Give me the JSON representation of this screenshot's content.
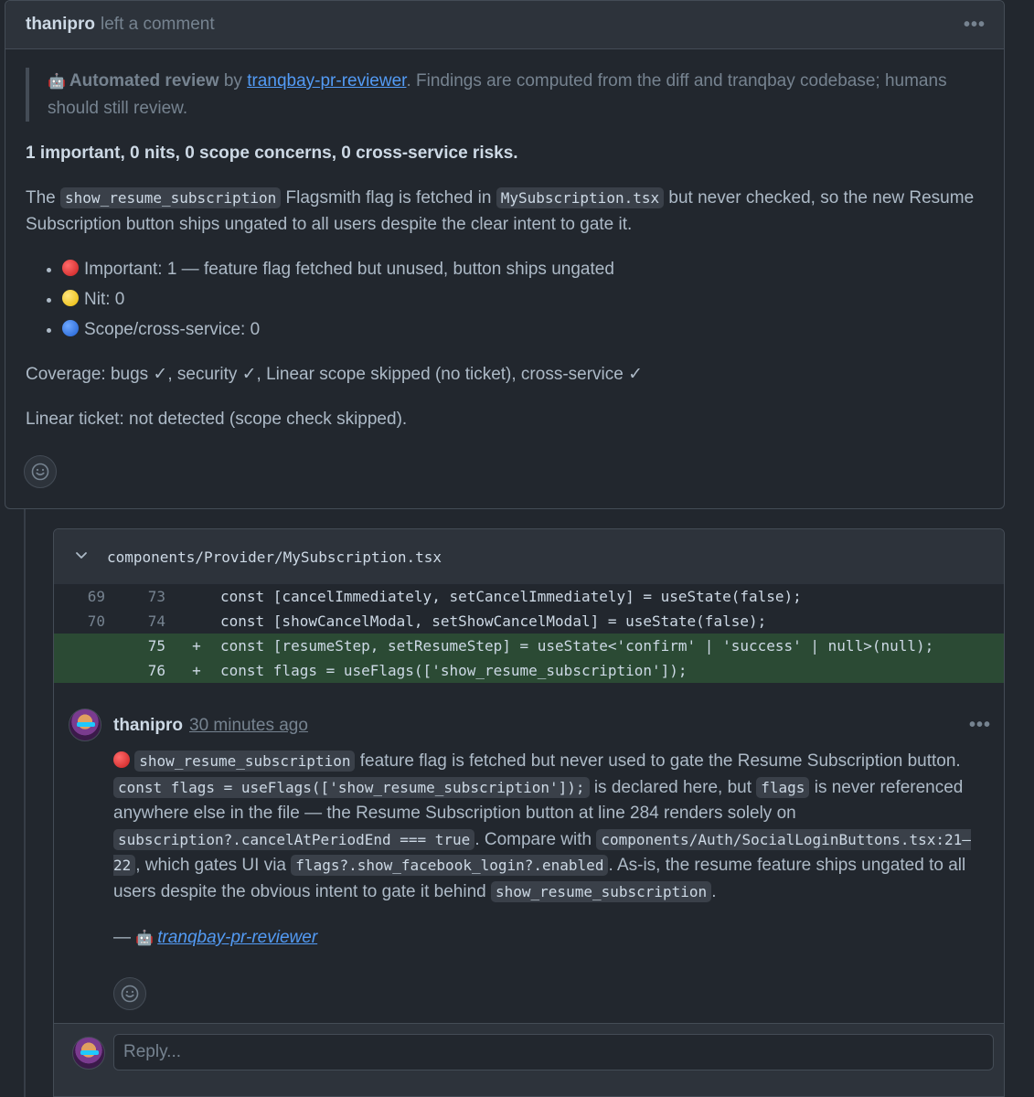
{
  "header": {
    "author": "thanipro",
    "action": "left a comment",
    "menu_label": "•••"
  },
  "review": {
    "quote_bot_emoji": "🤖",
    "quote_bold": "Automated review",
    "quote_by": " by ",
    "quote_link": "tranqbay-pr-reviewer",
    "quote_rest": ". Findings are computed from the diff and tranqbay codebase; humans should still review.",
    "summary": "1 important, 0 nits, 0 scope concerns, 0 cross-service risks.",
    "desc_1": "The ",
    "desc_code_1": "show_resume_subscription",
    "desc_2": " Flagsmith flag is fetched in ",
    "desc_code_2": "MySubscription.tsx",
    "desc_3": " but never checked, so the new Resume Subscription button ships ungated to all users despite the clear intent to gate it.",
    "bullets": [
      {
        "color": "#d73a3a",
        "text": "Important: 1 — feature flag fetched but unused, button ships ungated"
      },
      {
        "color": "#f2c40f",
        "text": "Nit: 0"
      },
      {
        "color": "#2a6fe0",
        "text": "Scope/cross-service: 0"
      }
    ],
    "coverage": "Coverage: bugs ✓, security ✓, Linear scope skipped (no ticket), cross-service ✓",
    "linear": "Linear ticket: not detected (scope check skipped)."
  },
  "file": {
    "path": "components/Provider/MySubscription.tsx",
    "lines": [
      {
        "old": "69",
        "new": "73",
        "sign": "",
        "code": "const [cancelImmediately, setCancelImmediately] = useState(false);",
        "added": false
      },
      {
        "old": "70",
        "new": "74",
        "sign": "",
        "code": "const [showCancelModal, setShowCancelModal] = useState(false);",
        "added": false
      },
      {
        "old": "",
        "new": "75",
        "sign": "+",
        "code": "const [resumeStep, setResumeStep] = useState<'confirm' | 'success' | null>(null);",
        "added": true
      },
      {
        "old": "",
        "new": "76",
        "sign": "+",
        "code": "const flags = useFlags(['show_resume_subscription']);",
        "added": true
      }
    ]
  },
  "comment": {
    "author": "thanipro",
    "time": "30 minutes ago",
    "menu_label": "•••",
    "t1": " ",
    "c1": "show_resume_subscription",
    "t2": " feature flag is fetched but never used to gate the Resume Subscription button. ",
    "c2": "const flags = useFlags(['show_resume_subscription']);",
    "t3": " is declared here, but ",
    "c3": "flags",
    "t4": " is never referenced anywhere else in the file — the Resume Subscription button at line 284 renders solely on ",
    "c4": "subscription?.cancelAtPeriodEnd === true",
    "t5": ". Compare with ",
    "c5": "components/Auth/SocialLoginButtons.tsx:21–22",
    "t6": ", which gates UI via ",
    "c6": "flags?.show_facebook_login?.enabled",
    "t7": ". As-is, the resume feature ships ungated to all users despite the obvious intent to gate it behind ",
    "c7": "show_resume_subscription",
    "t8": ".",
    "sig_dash": "— ",
    "sig_emoji": "🤖",
    "sig_link": "tranqbay-pr-reviewer"
  },
  "reply": {
    "placeholder": "Reply..."
  },
  "icons": {
    "smiley": "smiley-icon",
    "chevron": "chevron-down-icon",
    "robot": "robot-icon"
  }
}
